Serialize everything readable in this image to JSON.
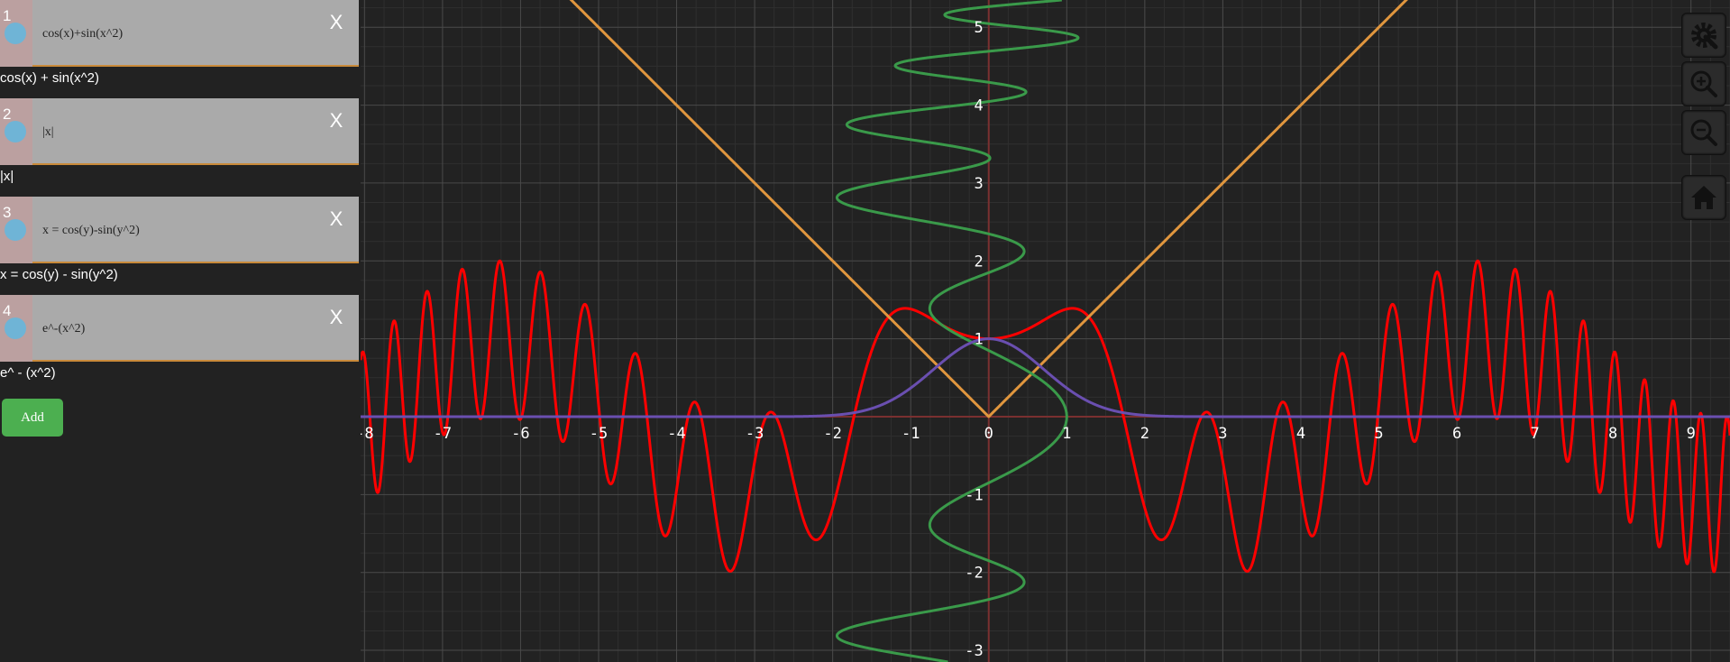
{
  "expressions": [
    {
      "index": "1",
      "value": "cos(x)+sin(x^2)",
      "rendered": "cos(x) + sin(x^2)",
      "close": "X",
      "color": "#ff0000"
    },
    {
      "index": "2",
      "value": "|x|",
      "rendered": "|x|",
      "close": "X",
      "color": "#e0963e"
    },
    {
      "index": "3",
      "value": "x = cos(y)-sin(y^2)",
      "rendered": "x = cos(y) - sin(y^2)",
      "close": "X",
      "color": "#3a9a4a"
    },
    {
      "index": "4",
      "value": "e^-(x^2)",
      "rendered": "e^ - (x^2)",
      "close": "X",
      "color": "#6a4fb0"
    }
  ],
  "add_button": "Add",
  "tools": [
    "settings-icon",
    "zoom-in-icon",
    "zoom-out-icon",
    "home-icon"
  ],
  "graph": {
    "x_ticks": [
      "-8",
      "-7",
      "-6",
      "-5",
      "-4",
      "-3",
      "-2",
      "-1",
      "0",
      "1",
      "2",
      "3",
      "4",
      "5",
      "6",
      "7",
      "8",
      "9"
    ],
    "y_ticks": [
      "5",
      "4",
      "3",
      "2",
      "1",
      "-1",
      "-2",
      "-3"
    ],
    "x_range": [
      -8.05,
      9.5
    ],
    "y_range": [
      -3.15,
      5.35
    ],
    "background": "#222222",
    "grid_major": "#4a4a4a",
    "grid_minor": "#2f2f2f",
    "axis_color": "#7a3030"
  }
}
